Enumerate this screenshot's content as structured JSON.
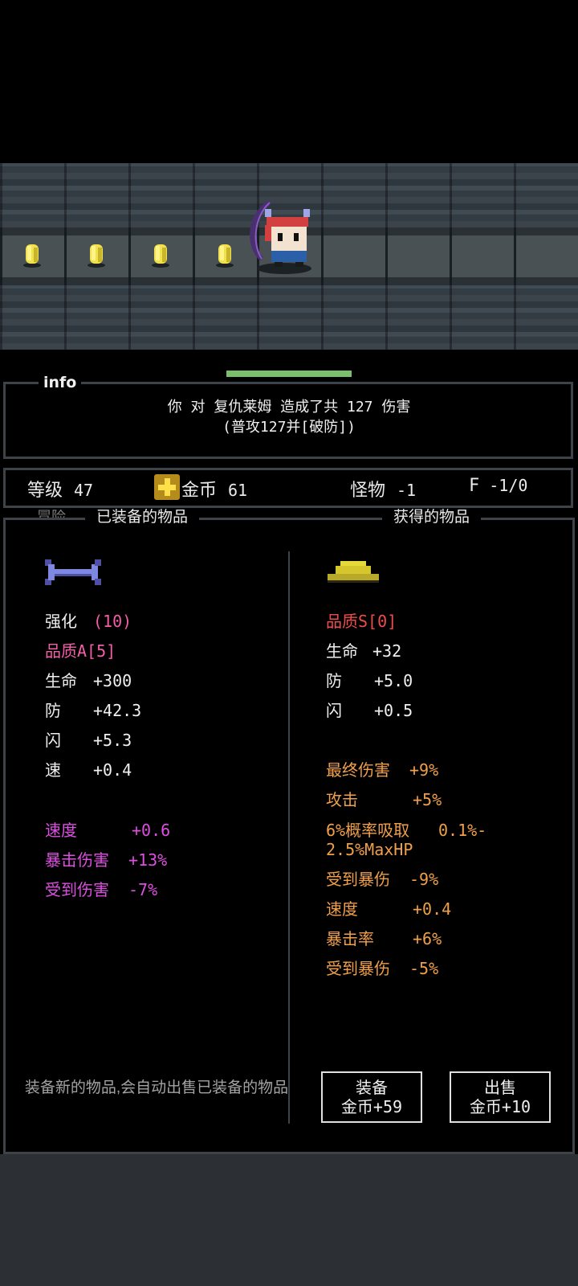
{
  "info": {
    "title": "info",
    "line1": "你 对 复仇莱姆 造成了共 127 伤害",
    "line2": "(普攻127并[破防])"
  },
  "stats": {
    "level_label": "等级",
    "level_value": "47",
    "gold_label": "金币",
    "gold_value": "61",
    "monster_label": "怪物",
    "monster_value": "-1",
    "floor_label": "F",
    "floor_value": "-1/0"
  },
  "equipped": {
    "ghost_tab": "冒险",
    "title": "已装备的物品",
    "icon": "bow-weapon-icon",
    "rows": [
      {
        "label": "强化",
        "value": "(10)",
        "color": "white",
        "value_color": "#f25ea7"
      },
      {
        "label": "品质A[5]",
        "value": "",
        "color": "#f25ea7"
      },
      {
        "label": "生命",
        "value": "+300",
        "color": "white"
      },
      {
        "label": "防",
        "value": "+42.3",
        "color": "white"
      },
      {
        "label": "闪",
        "value": "+5.3",
        "color": "white"
      },
      {
        "label": "速",
        "value": "+0.4",
        "color": "white"
      },
      {
        "label": "速度",
        "value": "+0.6",
        "color": "#dd4fe0"
      },
      {
        "label": "暴击伤害",
        "value": "+13%",
        "color": "#dd4fe0"
      },
      {
        "label": "受到伤害",
        "value": "-7%",
        "color": "#dd4fe0"
      }
    ],
    "note": "装备新的物品,会自动出售已装备的物品"
  },
  "obtained": {
    "title": "获得的物品",
    "icon": "hat-icon",
    "rows": [
      {
        "label": "品质S[0]",
        "value": "",
        "color": "#f04c4c"
      },
      {
        "label": "生命",
        "value": "+32",
        "color": "white"
      },
      {
        "label": "防",
        "value": "+5.0",
        "color": "white"
      },
      {
        "label": "闪",
        "value": "+0.5",
        "color": "white"
      },
      {
        "label": "最终伤害",
        "value": "+9%",
        "color": "#f0a04a"
      },
      {
        "label": "攻击",
        "value": "+5%",
        "color": "#f0a04a"
      },
      {
        "label": "6%概率吸取",
        "value": "0.1%-",
        "color": "#f0a04a"
      },
      {
        "label": "2.5%MaxHP",
        "value": "",
        "color": "#f0a04a"
      },
      {
        "label": "受到暴伤",
        "value": "-9%",
        "color": "#f0a04a"
      },
      {
        "label": "速度",
        "value": "+0.4",
        "color": "#f0a04a"
      },
      {
        "label": "暴击率",
        "value": "+6%",
        "color": "#f0a04a"
      },
      {
        "label": "受到暴伤",
        "value": "-5%",
        "color": "#f0a04a"
      }
    ]
  },
  "buttons": {
    "equip_line1": "装备",
    "equip_line2": "金币+59",
    "sell_line1": "出售",
    "sell_line2": "金币+10"
  },
  "colors": {
    "panel_border": "#3d4348",
    "hp_bar": "#7bbf6a",
    "gold": "#ffe04a"
  }
}
